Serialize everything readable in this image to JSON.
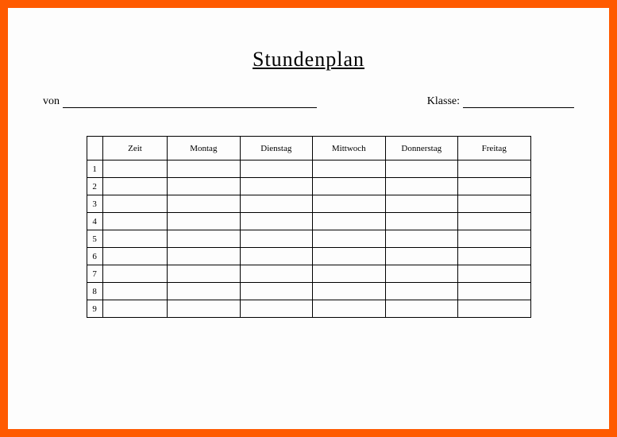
{
  "title": "Stundenplan",
  "labels": {
    "von": "von",
    "klasse": "Klasse:"
  },
  "columns": {
    "num": "",
    "zeit": "Zeit",
    "montag": "Montag",
    "dienstag": "Dienstag",
    "mittwoch": "Mittwoch",
    "donnerstag": "Donnerstag",
    "freitag": "Freitag"
  },
  "rows": [
    {
      "num": "1",
      "zeit": "",
      "montag": "",
      "dienstag": "",
      "mittwoch": "",
      "donnerstag": "",
      "freitag": ""
    },
    {
      "num": "2",
      "zeit": "",
      "montag": "",
      "dienstag": "",
      "mittwoch": "",
      "donnerstag": "",
      "freitag": ""
    },
    {
      "num": "3",
      "zeit": "",
      "montag": "",
      "dienstag": "",
      "mittwoch": "",
      "donnerstag": "",
      "freitag": ""
    },
    {
      "num": "4",
      "zeit": "",
      "montag": "",
      "dienstag": "",
      "mittwoch": "",
      "donnerstag": "",
      "freitag": ""
    },
    {
      "num": "5",
      "zeit": "",
      "montag": "",
      "dienstag": "",
      "mittwoch": "",
      "donnerstag": "",
      "freitag": ""
    },
    {
      "num": "6",
      "zeit": "",
      "montag": "",
      "dienstag": "",
      "mittwoch": "",
      "donnerstag": "",
      "freitag": ""
    },
    {
      "num": "7",
      "zeit": "",
      "montag": "",
      "dienstag": "",
      "mittwoch": "",
      "donnerstag": "",
      "freitag": ""
    },
    {
      "num": "8",
      "zeit": "",
      "montag": "",
      "dienstag": "",
      "mittwoch": "",
      "donnerstag": "",
      "freitag": ""
    },
    {
      "num": "9",
      "zeit": "",
      "montag": "",
      "dienstag": "",
      "mittwoch": "",
      "donnerstag": "",
      "freitag": ""
    }
  ]
}
